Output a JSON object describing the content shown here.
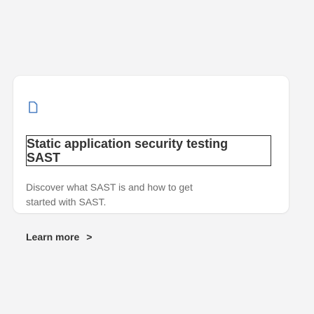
{
  "card": {
    "icon": "document-icon",
    "title_line1": "Static application security testing",
    "title_line2": "SAST",
    "description": "Discover what SAST is and how to get started with SAST.",
    "link_label": "Learn more",
    "link_chevron": ">"
  },
  "colors": {
    "background": "#f4f4f5",
    "card": "#ffffff",
    "title": "#333333",
    "description": "#6b6b6b",
    "icon": "#4a7fc1"
  }
}
